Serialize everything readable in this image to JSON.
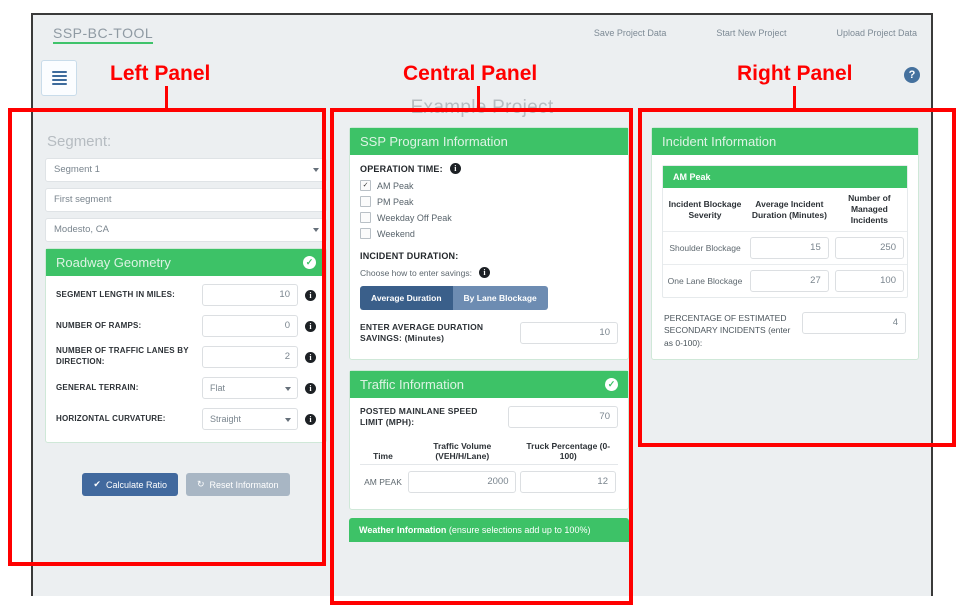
{
  "header": {
    "brand": "SSP-BC-TOOL",
    "nav_links": [
      "Save Project Data",
      "Start New Project",
      "Upload Project Data"
    ],
    "menu_icon": "hamburger-icon",
    "help_icon": "help-icon",
    "help_glyph": "?",
    "project_title": "Example Project"
  },
  "annotations": {
    "left": "Left Panel",
    "center": "Central Panel",
    "right": "Right Panel",
    "color": "#ff0000"
  },
  "left_panel": {
    "section_title": "Segment:",
    "segment_select": "Segment 1",
    "segment_name": "First segment",
    "location_select": "Modesto, CA",
    "card_title": "Roadway Geometry",
    "card_complete": true,
    "fields": [
      {
        "label": "SEGMENT LENGTH IN MILES:",
        "value": "10",
        "type": "input"
      },
      {
        "label": "NUMBER OF RAMPS:",
        "value": "0",
        "type": "input"
      },
      {
        "label": "NUMBER OF TRAFFIC LANES BY DIRECTION:",
        "value": "2",
        "type": "input"
      },
      {
        "label": "GENERAL TERRAIN:",
        "value": "Flat",
        "type": "select"
      },
      {
        "label": "HORIZONTAL CURVATURE:",
        "value": "Straight",
        "type": "select"
      }
    ],
    "calculate_button": "Calculate Ratio",
    "reset_button": "Reset Informaton"
  },
  "center_panel": {
    "ssp": {
      "title": "SSP Program Information",
      "operation_time_label": "OPERATION TIME:",
      "options": [
        {
          "label": "AM Peak",
          "checked": true
        },
        {
          "label": "PM Peak",
          "checked": false
        },
        {
          "label": "Weekday Off Peak",
          "checked": false
        },
        {
          "label": "Weekend",
          "checked": false
        }
      ],
      "incident_duration_label": "INCIDENT DURATION:",
      "choose_label": "Choose how to enter savings:",
      "toggle_a": "Average Duration",
      "toggle_b": "By Lane Blockage",
      "avg_duration_label": "ENTER AVERAGE DURATION SAVINGS: (Minutes)",
      "avg_duration_value": "10"
    },
    "traffic": {
      "title": "Traffic Information",
      "complete": true,
      "speed_label": "POSTED MAINLANE SPEED LIMIT (MPH):",
      "speed_value": "70",
      "columns": [
        "Time",
        "Traffic Volume (VEH/H/Lane)",
        "Truck Percentage (0-100)"
      ],
      "rows": [
        {
          "time": "AM PEAK",
          "volume": "2000",
          "truck_pct": "12"
        }
      ]
    },
    "weather": {
      "title_bold": "Weather Information",
      "title_rest": "(ensure selections add up to 100%)"
    }
  },
  "right_panel": {
    "title": "Incident Information",
    "period": "AM Peak",
    "columns": [
      "Incident Blockage Severity",
      "Average Incident Duration (Minutes)",
      "Number of Managed Incidents"
    ],
    "rows": [
      {
        "severity": "Shoulder Blockage",
        "duration": "15",
        "incidents": "250"
      },
      {
        "severity": "One Lane Blockage",
        "duration": "27",
        "incidents": "100"
      }
    ],
    "secondary_label": "PERCENTAGE OF ESTIMATED SECONDARY INCIDENTS (enter as 0-100):",
    "secondary_value": "4"
  },
  "colors": {
    "green": "#3dc267",
    "blue": "#41699e",
    "muted_blue": "#a8b6c4",
    "page_bg": "#eceff1",
    "annotation_red": "#ff0000"
  }
}
